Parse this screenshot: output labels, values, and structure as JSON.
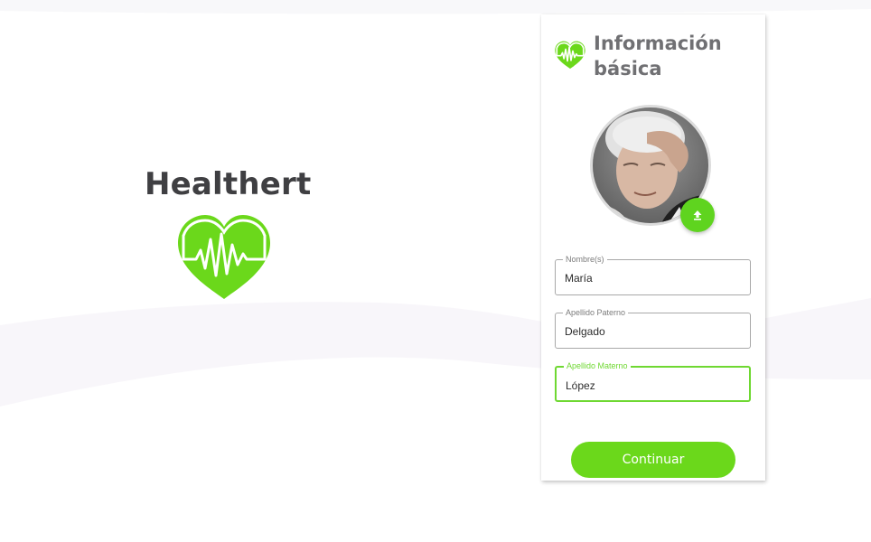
{
  "brand": {
    "name": "Healthert",
    "logo_icon": "heart-pulse-icon",
    "color": "#6bd81b"
  },
  "screen": {
    "title": "Información básica",
    "header_icon": "heart-pulse-icon",
    "avatar_icon": "profile-photo",
    "upload_icon": "upload-icon"
  },
  "form": {
    "nombre": {
      "label": "Nombre(s)",
      "value": "María"
    },
    "apellido_paterno": {
      "label": "Apellido Paterno",
      "value": "Delgado"
    },
    "apellido_materno": {
      "label": "Apellido Materno",
      "value": "López"
    }
  },
  "actions": {
    "continue_label": "Continuar"
  },
  "colors": {
    "accent": "#6bd81b",
    "active_border": "#6fd832",
    "title_gray": "#707073",
    "brand_text": "#3f3f42"
  }
}
